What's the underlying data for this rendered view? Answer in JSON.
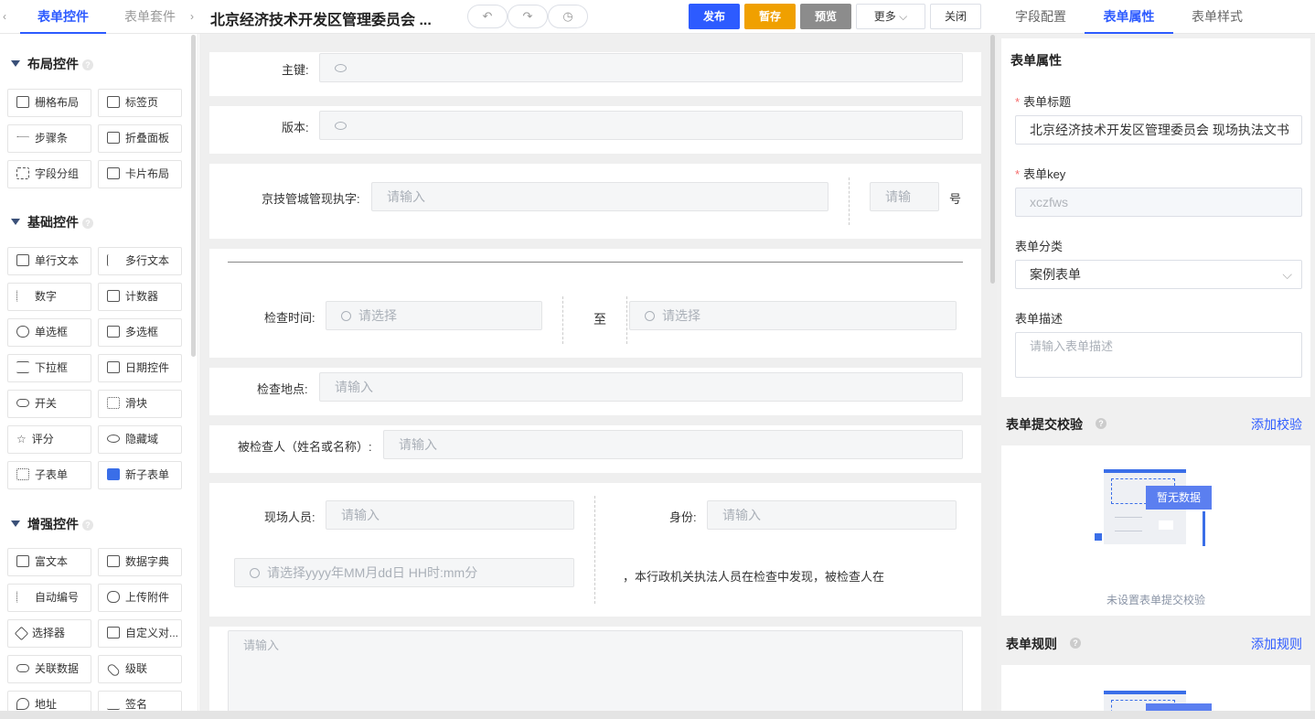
{
  "left_tabs": {
    "active": "表单控件",
    "other": "表单套件"
  },
  "window": {
    "title": "北京经济技术开发区管理委员会 ..."
  },
  "toolbar": {
    "publish": "发布",
    "save_draft": "暂存",
    "preview": "预览",
    "more": "更多",
    "close": "关闭"
  },
  "right_tabs": [
    "字段配置",
    "表单属性",
    "表单样式"
  ],
  "sections": {
    "layout": {
      "title": "布局控件",
      "items": [
        "栅格布局",
        "标签页",
        "步骤条",
        "折叠面板",
        "字段分组",
        "卡片布局"
      ]
    },
    "basic": {
      "title": "基础控件",
      "items": [
        "单行文本",
        "多行文本",
        "数字",
        "计数器",
        "单选框",
        "多选框",
        "下拉框",
        "日期控件",
        "开关",
        "滑块",
        "评分",
        "隐藏域",
        "子表单",
        "新子表单"
      ]
    },
    "enhanced": {
      "title": "增强控件",
      "items": [
        "富文本",
        "数据字典",
        "自动编号",
        "上传附件",
        "选择器",
        "自定义对...",
        "关联数据",
        "级联",
        "地址",
        "签名"
      ]
    }
  },
  "form": {
    "primary_key_label": "主键:",
    "version_label": "版本:",
    "doc_number_label": "京技管城管现执字:",
    "doc_number_placeholder": "请输入",
    "number_placeholder": "请输",
    "number_suffix": "号",
    "check_time_label": "检查时间:",
    "select_placeholder": "请选择",
    "to_label": "至",
    "location_label": "检查地点:",
    "input_placeholder": "请输入",
    "inspected_label": "被检查人（姓名或名称）:",
    "staff_label": "现场人员:",
    "identity_label": "身份:",
    "datetime_placeholder": "请选择yyyy年MM月dd日 HH时:mm分",
    "statement_text": "，本行政机关执法人员在检查中发现，被检查人在",
    "textarea_placeholder": "请输入"
  },
  "props": {
    "section_title": "表单属性",
    "form_title_label": "表单标题",
    "form_title_value": "北京经济技术开发区管理委员会 现场执法文书",
    "form_key_label": "表单key",
    "form_key_value": "xczfws",
    "category_label": "表单分类",
    "category_value": "案例表单",
    "desc_label": "表单描述",
    "desc_placeholder": "请输入表单描述",
    "validation_title": "表单提交校验",
    "validation_link": "添加校验",
    "empty_badge": "暂无数据",
    "empty_text": "未设置表单提交校验",
    "rules_title": "表单规则",
    "rules_link": "添加规则"
  },
  "colors": {
    "accent": "#2d5bff",
    "publish": "#2d5bff",
    "save": "#f0a000",
    "preview": "#8c8c8c"
  }
}
